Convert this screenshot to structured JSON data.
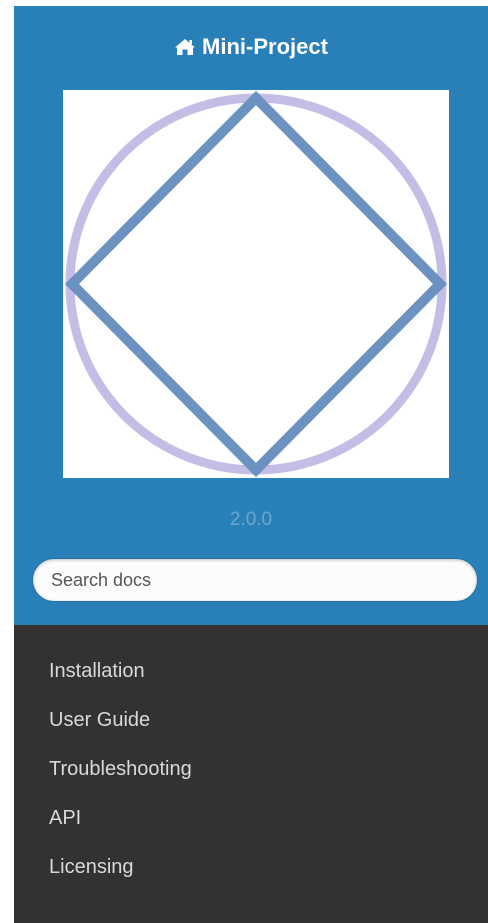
{
  "sidebar": {
    "project_title": "Mini-Project",
    "home_icon": "home-icon",
    "version": "2.0.0",
    "search": {
      "placeholder": "Search docs",
      "value": ""
    },
    "nav_items": [
      {
        "label": "Installation"
      },
      {
        "label": "User Guide"
      },
      {
        "label": "Troubleshooting"
      },
      {
        "label": "API"
      },
      {
        "label": "Licensing"
      }
    ]
  },
  "colors": {
    "header_bg": "#2980b9",
    "nav_bg": "#343131",
    "nav_text": "#d9d9d9",
    "logo_circle": "#c4bde6",
    "logo_diamond": "#6c92c2"
  }
}
